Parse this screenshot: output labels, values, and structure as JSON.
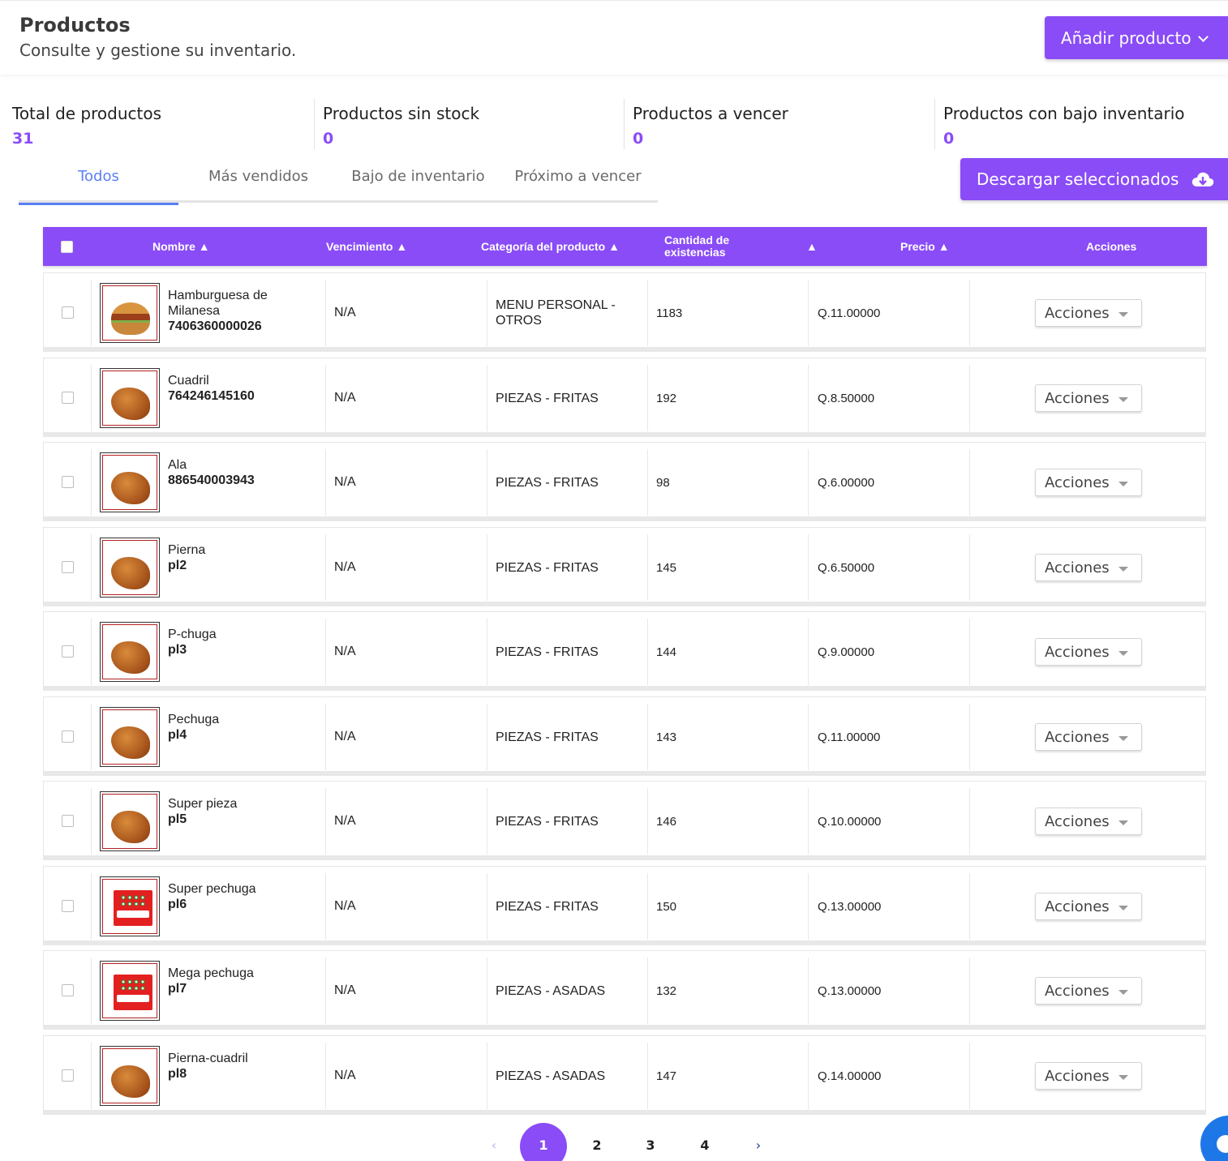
{
  "header": {
    "title": "Productos",
    "subtitle": "Consulte y gestione su inventario.",
    "add_button": "Añadir producto"
  },
  "stats": [
    {
      "label": "Total de productos",
      "value": "31"
    },
    {
      "label": "Productos sin stock",
      "value": "0"
    },
    {
      "label": "Productos a vencer",
      "value": "0"
    },
    {
      "label": "Productos con bajo inventario",
      "value": "0"
    }
  ],
  "tabs": [
    "Todos",
    "Más vendidos",
    "Bajo de inventario",
    "Próximo a vencer"
  ],
  "active_tab": "Todos",
  "download_button": "Descargar seleccionados",
  "table": {
    "headers": {
      "name": "Nombre ▲",
      "expiry": "Vencimiento ▲",
      "category": "Categoría del producto ▲",
      "stock": "Cantidad de existencias",
      "stock_sort": "▲",
      "price": "Precio ▲",
      "actions": "Acciones"
    },
    "action_label": "Acciones",
    "rows": [
      {
        "name": "Hamburguesa de Milanesa",
        "code": "7406360000026",
        "expiry": "N/A",
        "category": "MENU PERSONAL - OTROS",
        "stock": "1183",
        "price": "Q.11.00000",
        "image": "burger"
      },
      {
        "name": "Cuadril",
        "code": "764246145160",
        "expiry": "N/A",
        "category": "PIEZAS - FRITAS",
        "stock": "192",
        "price": "Q.8.50000",
        "image": "chicken"
      },
      {
        "name": "Ala",
        "code": "886540003943",
        "expiry": "N/A",
        "category": "PIEZAS - FRITAS",
        "stock": "98",
        "price": "Q.6.00000",
        "image": "chicken"
      },
      {
        "name": "Pierna",
        "code": "pl2",
        "expiry": "N/A",
        "category": "PIEZAS - FRITAS",
        "stock": "145",
        "price": "Q.6.50000",
        "image": "chicken"
      },
      {
        "name": "P-chuga",
        "code": "pl3",
        "expiry": "N/A",
        "category": "PIEZAS - FRITAS",
        "stock": "144",
        "price": "Q.9.00000",
        "image": "chicken"
      },
      {
        "name": "Pechuga",
        "code": "pl4",
        "expiry": "N/A",
        "category": "PIEZAS - FRITAS",
        "stock": "143",
        "price": "Q.11.00000",
        "image": "chicken"
      },
      {
        "name": "Super pieza",
        "code": "pl5",
        "expiry": "N/A",
        "category": "PIEZAS - FRITAS",
        "stock": "146",
        "price": "Q.10.00000",
        "image": "chicken"
      },
      {
        "name": "Super pechuga",
        "code": "pl6",
        "expiry": "N/A",
        "category": "PIEZAS - FRITAS",
        "stock": "150",
        "price": "Q.13.00000",
        "image": "logo"
      },
      {
        "name": "Mega pechuga",
        "code": "pl7",
        "expiry": "N/A",
        "category": "PIEZAS - ASADAS",
        "stock": "132",
        "price": "Q.13.00000",
        "image": "logo"
      },
      {
        "name": "Pierna-cuadril",
        "code": "pl8",
        "expiry": "N/A",
        "category": "PIEZAS - ASADAS",
        "stock": "147",
        "price": "Q.14.00000",
        "image": "chicken"
      }
    ]
  },
  "pagination": {
    "pages": [
      "1",
      "2",
      "3",
      "4"
    ],
    "current": "1",
    "prev": "‹",
    "next": "›"
  },
  "colors": {
    "accent": "#8a4cf7",
    "tab_active": "#5a7ff5",
    "chat_fab": "#1e77e6"
  }
}
